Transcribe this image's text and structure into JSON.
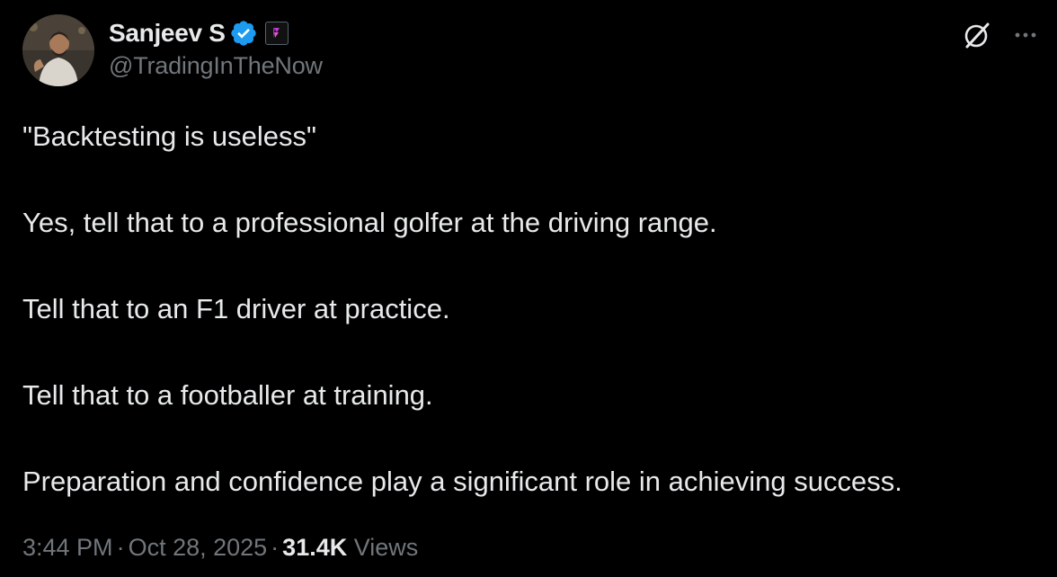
{
  "author": {
    "display_name": "Sanjeev S",
    "handle": "@TradingInTheNow",
    "avatar_icon": "profile-photo",
    "verified_icon": "verified-badge-icon",
    "affiliation_icon": "affiliate-badge-icon"
  },
  "actions": {
    "grok_icon": "grok-icon",
    "more_icon": "more-horizontal-icon"
  },
  "tweet": {
    "paragraphs": [
      "\"Backtesting is useless\"",
      "Yes, tell that to a professional golfer at the driving range.",
      "Tell that to an F1 driver at practice.",
      "Tell that to a footballer at training.",
      "Preparation and confidence play a significant role in achieving success."
    ]
  },
  "meta": {
    "time": "3:44 PM",
    "separator": "·",
    "date": "Oct 28, 2025",
    "views_count": "31.4K",
    "views_label": "Views"
  },
  "colors": {
    "background": "#000000",
    "text_primary": "#e7e9ea",
    "text_secondary": "#71767b",
    "verified_blue": "#1d9bf0",
    "affiliate_pink": "#c13ccf"
  }
}
